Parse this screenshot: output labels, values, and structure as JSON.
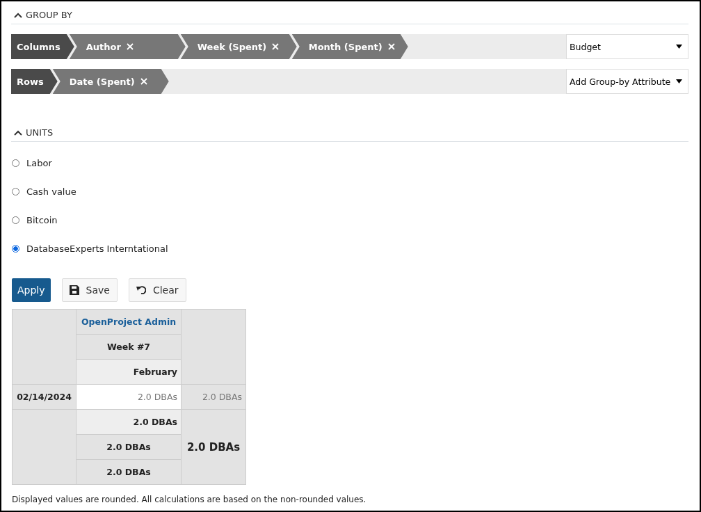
{
  "group_by": {
    "title": "GROUP BY",
    "columns": {
      "label": "Columns",
      "chips": [
        "Author",
        "Week (Spent)",
        "Month (Spent)"
      ],
      "select": "Budget"
    },
    "rows": {
      "label": "Rows",
      "chips": [
        "Date (Spent)"
      ],
      "select": "Add Group-by Attribute"
    }
  },
  "units": {
    "title": "UNITS",
    "options": [
      {
        "label": "Labor",
        "selected": false
      },
      {
        "label": "Cash value",
        "selected": false
      },
      {
        "label": "Bitcoin",
        "selected": false
      },
      {
        "label": "DatabaseExperts Interntational",
        "selected": true
      }
    ]
  },
  "buttons": {
    "apply": "Apply",
    "save": "Save",
    "clear": "Clear"
  },
  "table": {
    "author": "OpenProject Admin",
    "week": "Week #7",
    "month": "February",
    "row": {
      "date": "02/14/2024",
      "value": "2.0 DBAs",
      "total": "2.0 DBAs"
    },
    "month_total": "2.0 DBAs",
    "week_total": "2.0 DBAs",
    "author_total": "2.0 DBAs",
    "grand_total": "2.0 DBAs"
  },
  "footnote": "Displayed values are rounded. All calculations are based on the non-rounded values."
}
